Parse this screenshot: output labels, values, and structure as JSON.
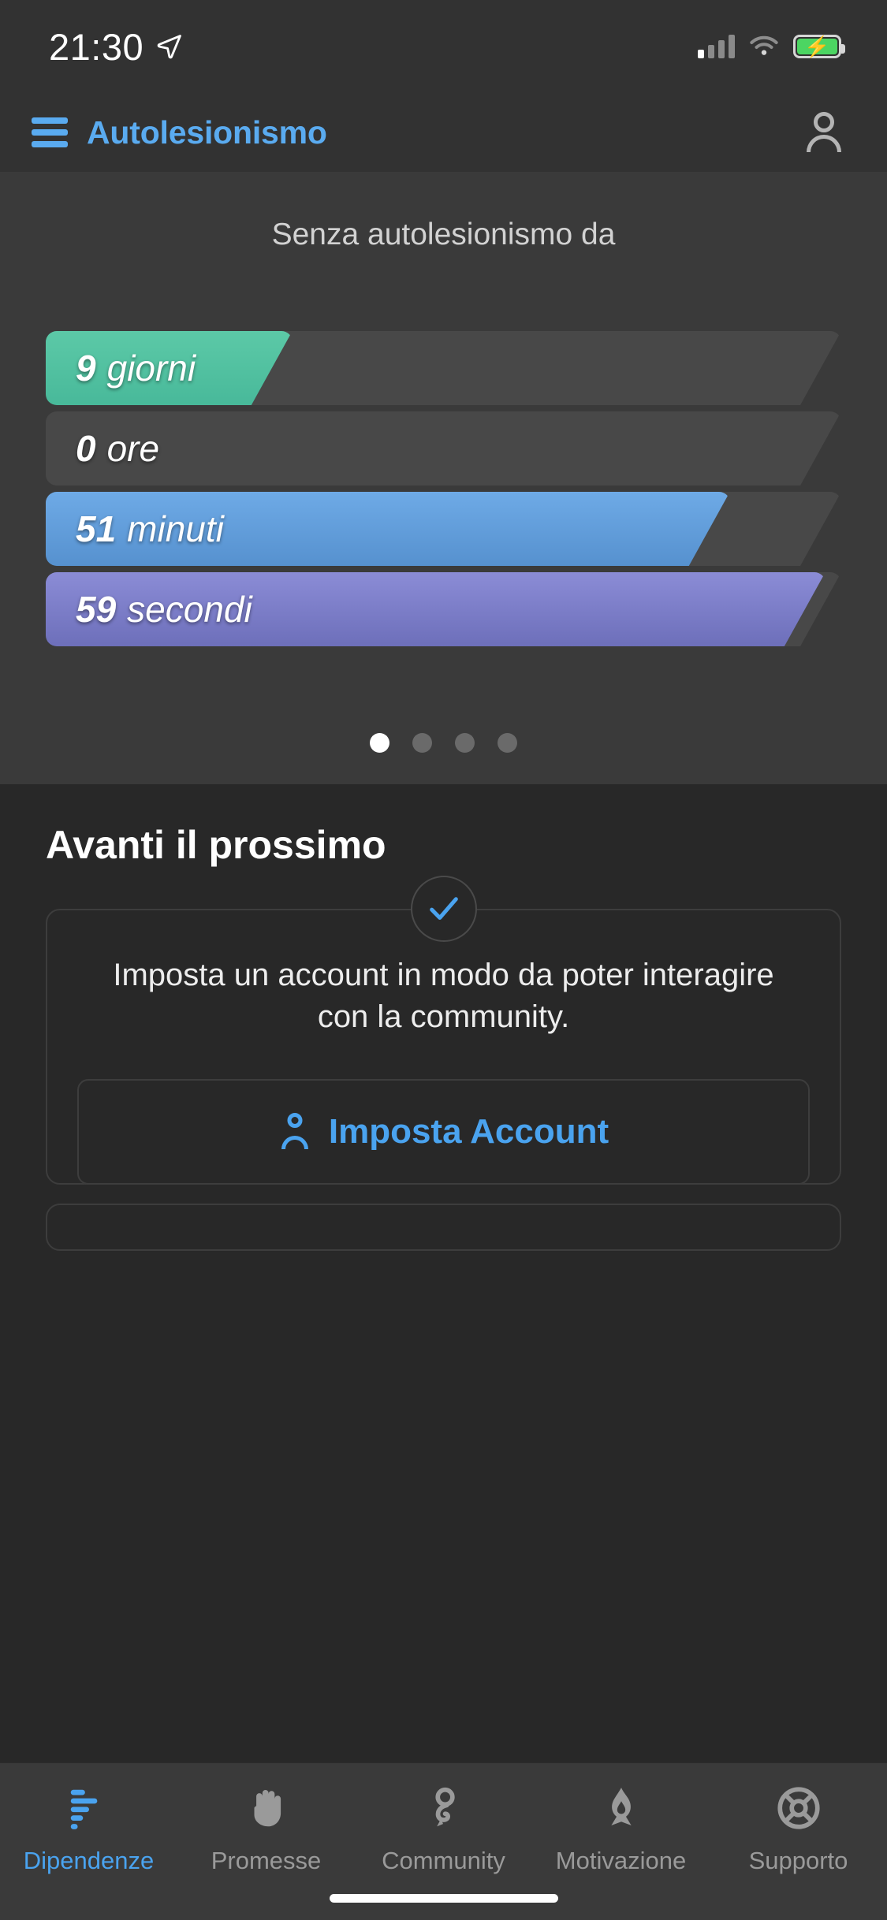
{
  "status_bar": {
    "time": "21:30",
    "location_icon": "location-arrow-icon",
    "signal_icon": "cellular-signal-icon",
    "wifi_icon": "wifi-icon",
    "battery_icon": "battery-charging-icon"
  },
  "header": {
    "menu_icon": "hamburger-menu-icon",
    "title": "Autolesionismo",
    "account_icon": "account-person-icon",
    "accent_color": "#5aabf0"
  },
  "counter": {
    "caption": "Senza autolesionismo da",
    "bars": [
      {
        "value": "9",
        "unit": "giorni",
        "fill_percent": 31,
        "color": "#5cc9a7",
        "color_end": "#48b99a"
      },
      {
        "value": "0",
        "unit": "ore",
        "fill_percent": 0,
        "color": "#484848",
        "color_end": "#484848"
      },
      {
        "value": "51",
        "unit": "minuti",
        "fill_percent": 86,
        "color": "#6eaae6",
        "color_end": "#5691cf"
      },
      {
        "value": "59",
        "unit": "secondi",
        "fill_percent": 98,
        "color": "#8b8cd6",
        "color_end": "#6d6fba"
      }
    ],
    "pager": {
      "total": 4,
      "active_index": 0
    }
  },
  "next_up": {
    "heading": "Avanti il prossimo",
    "cards": [
      {
        "badge_icon": "checkmark-icon",
        "badge_color": "#4aa3ef",
        "text": "Imposta un account in modo da poter interagire con la community.",
        "action_icon": "person-icon",
        "action_label": "Imposta Account"
      }
    ]
  },
  "tab_bar": {
    "items": [
      {
        "label": "Dipendenze",
        "icon": "bar-chart-icon",
        "active": true
      },
      {
        "label": "Promesse",
        "icon": "hand-icon",
        "active": false
      },
      {
        "label": "Community",
        "icon": "community-icon",
        "active": false
      },
      {
        "label": "Motivazione",
        "icon": "flame-icon",
        "active": false
      },
      {
        "label": "Supporto",
        "icon": "life-ring-icon",
        "active": false
      }
    ],
    "active_color": "#4aa3ef",
    "inactive_color": "#9a9a9a"
  }
}
